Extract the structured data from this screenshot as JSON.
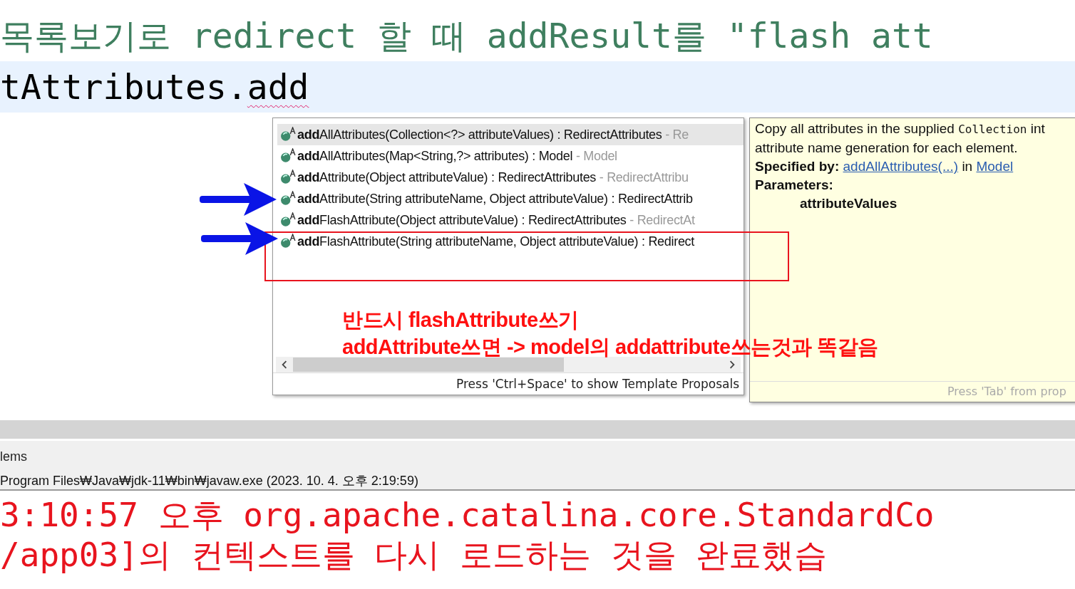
{
  "editor": {
    "lines": [
      {
        "kind": "comment",
        "text": "목록보기로 redirect 할 때 addResult를 \"flash att",
        "current": false
      },
      {
        "kind": "code",
        "text": "tAttributes.",
        "flagged": "add",
        "current": true
      }
    ]
  },
  "proposals": {
    "items": [
      {
        "signature": "**add**AllAttributes(Collection<?> attributeValues) : RedirectAttributes",
        "declaring": "- Re",
        "selected": true
      },
      {
        "signature": "**add**AllAttributes(Map<String,?> attributes) : Model",
        "declaring": "- Model",
        "selected": false
      },
      {
        "signature": "**add**Attribute(Object attributeValue) : RedirectAttributes",
        "declaring": "- RedirectAttribu",
        "selected": false
      },
      {
        "signature": "**add**Attribute(String attributeName, Object attributeValue) : RedirectAttrib",
        "selected": false
      },
      {
        "signature": "**add**FlashAttribute(Object attributeValue) : RedirectAttributes",
        "declaring": "- RedirectAt",
        "selected": false
      },
      {
        "signature": "**add**FlashAttribute(String attributeName, Object attributeValue) : Redirect",
        "selected": false
      }
    ],
    "status": "Press 'Ctrl+Space' to show Template Proposals"
  },
  "doc": {
    "description": [
      {
        "kind": "plain",
        "text": "Copy all attributes in the supplied "
      },
      {
        "kind": "code",
        "text": "Collection"
      },
      {
        "kind": "plain",
        "text": " int"
      }
    ],
    "description_2": "attribute name generation for each element.",
    "specified_label": "Specified by:",
    "specified_link": "addAllAttributes(...)",
    "specified_in": "in",
    "specified_type": "Model",
    "parameters_label": "Parameters:",
    "parameter": "attributeValues",
    "status": "Press 'Tab' from prop"
  },
  "annotation": {
    "lines": [
      "반드시 flashAttribute쓰기",
      "addAttribute쓰면 -> model의 addattribute쓰는것과 똑같음"
    ]
  },
  "bottom": {
    "tab": "lems",
    "console_header": "Program Files₩Java₩jdk-11₩bin₩javaw.exe  (2023. 10. 4. 오후 2:19:59)",
    "console_lines": [
      "3:10:57 오후 org.apache.catalina.core.StandardCo",
      "/app03]의 컨텍스트를 다시 로드하는 것을 완료했습"
    ]
  }
}
